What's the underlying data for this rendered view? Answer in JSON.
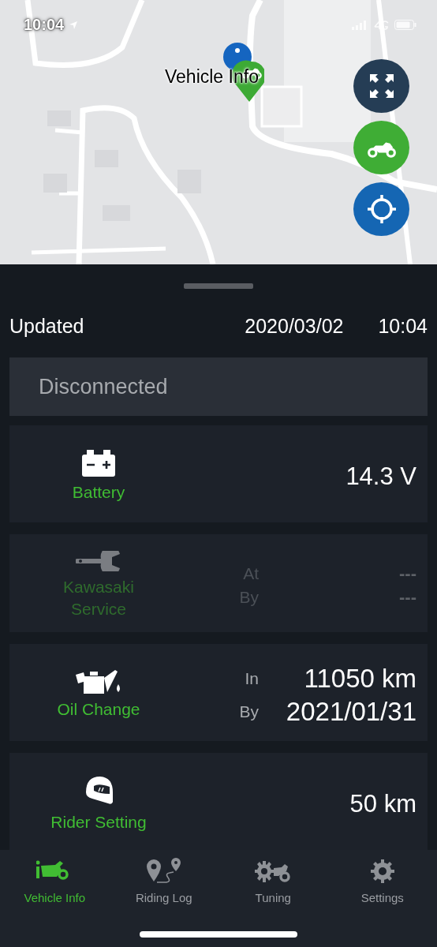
{
  "status_bar": {
    "time": "10:04"
  },
  "map": {
    "marker_label": "Vehicle Info"
  },
  "updated": {
    "label": "Updated",
    "date": "2020/03/02",
    "time": "10:04"
  },
  "connection": {
    "text": "Disconnected"
  },
  "cards": [
    {
      "kind": "single",
      "label": "Battery",
      "disabled": false,
      "value": "14.3 V"
    },
    {
      "kind": "pair",
      "label": "Kawasaki Service",
      "disabled": true,
      "rows": [
        {
          "label": "At",
          "value": "---"
        },
        {
          "label": "By",
          "value": "---"
        }
      ]
    },
    {
      "kind": "pair",
      "label": "Oil Change",
      "disabled": false,
      "rows": [
        {
          "label": "In",
          "value": "11050 km"
        },
        {
          "label": "By",
          "value": "2021/01/31"
        }
      ]
    },
    {
      "kind": "single",
      "label": "Rider Setting",
      "disabled": false,
      "value": "50 km"
    }
  ],
  "tabs": [
    {
      "label": "Vehicle Info",
      "selected": true
    },
    {
      "label": "Riding Log",
      "selected": false
    },
    {
      "label": "Tuning",
      "selected": false
    },
    {
      "label": "Settings",
      "selected": false
    }
  ]
}
